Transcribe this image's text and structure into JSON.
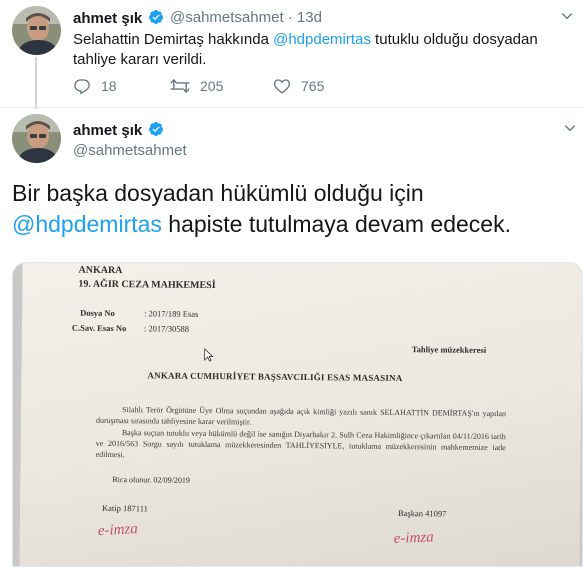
{
  "tweet1": {
    "name": "ahmet şık",
    "handle_time": "@sahmetsahmet · 13d",
    "text_pre": "Selahattin Demirtaş hakkında ",
    "mention": "@hdpdemirtas",
    "text_post": " tutuklu olduğu dosyadan tahliye kararı verildi.",
    "reply_count": "18",
    "retweet_count": "205",
    "like_count": "765"
  },
  "tweet2": {
    "name": "ahmet şık",
    "handle": "@sahmetsahmet",
    "text_pre": "Bir başka dosyadan hükümlü olduğu için ",
    "mention": "@hdpdemirtas",
    "text_post": " hapiste tutulmaya devam edecek."
  },
  "document": {
    "city": "ANKARA",
    "court": "19. AĞIR CEZA MAHKEMESİ",
    "dosya_label": "Dosya No",
    "dosya_value": ": 2017/189 Esas",
    "csav_label": "C.Sav. Esas No",
    "csav_value": ": 2017/30588",
    "doc_type": "Tahliye müzekkeresi",
    "recipient": "ANKARA CUMHURİYET BAŞSAVCILIĞI ESAS MASASINA",
    "body1": "Silahlı Terör Örgütüne Üye Olma suçundan aşağıda açık kimliği yazılı sanık SELAHATTİN DEMİRTAŞ'ın yapılan duruşması sırasında tahliyesine karar verilmiştir.",
    "body2": "Başka suçtan tutuklu veya hükümlü değil ise sanığın Diyarbakır 2. Sulh Ceza Hakimliğince çıkartılan 04/11/2016 tarih ve 2016/563 Sorgu sayılı tutuklama müzekkeresinden TAHLİYESİYLE, tutuklama müzekkeresinin mahkememize iade edilmesi.",
    "date": "Rica olunur. 02/09/2019",
    "katip": "Katip 187111",
    "baskan": "Başkan 41097",
    "signature": "e-imza"
  },
  "colors": {
    "accent": "#1da1f2",
    "secondary_text": "#657786",
    "verified": "#1da1f2"
  },
  "icons": [
    "verified-badge-icon",
    "chevron-down-icon",
    "reply-icon",
    "retweet-icon",
    "like-icon"
  ]
}
